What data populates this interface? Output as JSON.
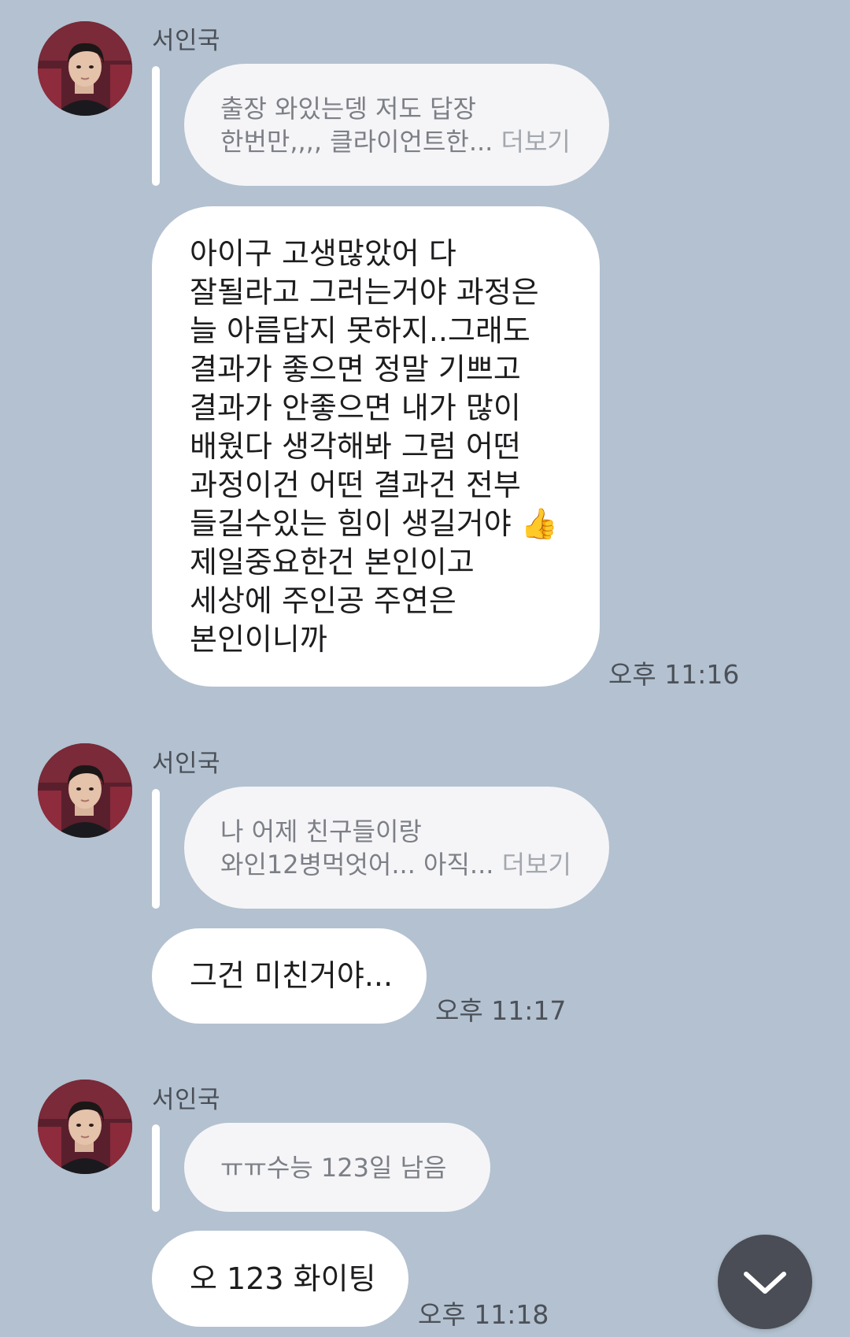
{
  "colors": {
    "background": "#b3c1d0",
    "bubble": "#ffffff",
    "quote_bubble": "#f5f5f7",
    "scroll_button": "#4a4d55"
  },
  "messages": [
    {
      "sender": "서인국",
      "quote": {
        "lines": [
          "출장 와있는뎅 저도 답장",
          "한번만,,,, 클라이언트한..."
        ],
        "more": "더보기"
      },
      "reply_lines": [
        "아이구 고생많았어 다",
        "잘될라고 그러는거야 과정은",
        "늘 아름답지 못하지..그래도",
        "결과가 좋으면 정말 기쁘고",
        "결과가 안좋으면 내가 많이",
        "배웠다 생각해봐 그럼 어떤",
        "과정이건 어떤 결과건 전부",
        "들길수있는 힘이 생길거야 👍",
        "제일중요한건 본인이고",
        "세상에 주인공 주연은",
        "본인이니까"
      ],
      "time": "오후 11:16"
    },
    {
      "sender": "서인국",
      "quote": {
        "lines": [
          "나 어제 친구들이랑",
          "와인12병먹엇어... 아직..."
        ],
        "more": "더보기"
      },
      "reply_lines": [
        "그건 미친거야..."
      ],
      "time": "오후 11:17"
    },
    {
      "sender": "서인국",
      "quote": {
        "lines": [
          "ㅠㅠ수능 123일 남음"
        ],
        "more": ""
      },
      "reply_lines": [
        "오 123 화이팅"
      ],
      "time": "오후 11:18"
    }
  ],
  "scroll_button": {
    "icon": "chevron-down-icon"
  }
}
